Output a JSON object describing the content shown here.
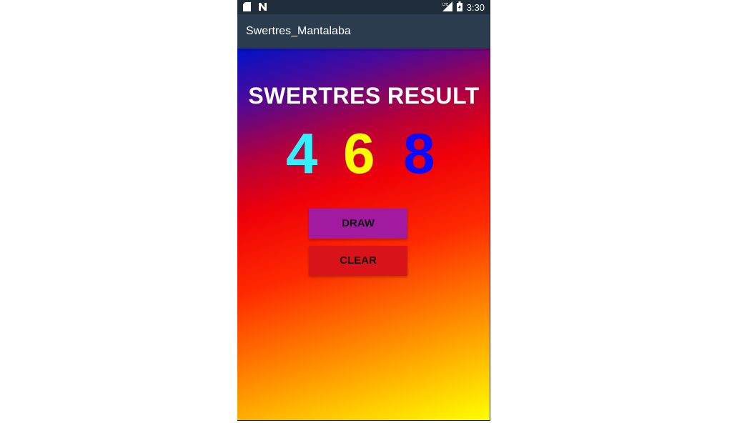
{
  "status_bar": {
    "time": "3:30",
    "icons": [
      "sd-card-icon",
      "n-notification-icon",
      "lte-signal-icon",
      "battery-icon"
    ]
  },
  "app_bar": {
    "title": "Swertres_Mantalaba"
  },
  "main": {
    "heading": "SWERTRES RESULT",
    "digits": [
      {
        "value": "4",
        "color": "#33f0ff"
      },
      {
        "value": "6",
        "color": "#ffff00"
      },
      {
        "value": "8",
        "color": "#0a0aff"
      }
    ],
    "buttons": {
      "draw": {
        "label": "DRAW",
        "color": "#a21aa0"
      },
      "clear": {
        "label": "CLEAR",
        "color": "#d8141a"
      }
    }
  },
  "colors": {
    "status_bar": "#1f2d3b",
    "app_bar": "#2b3c4e",
    "gradient_top": "#0012c8",
    "gradient_bottom": "#ffff00"
  }
}
